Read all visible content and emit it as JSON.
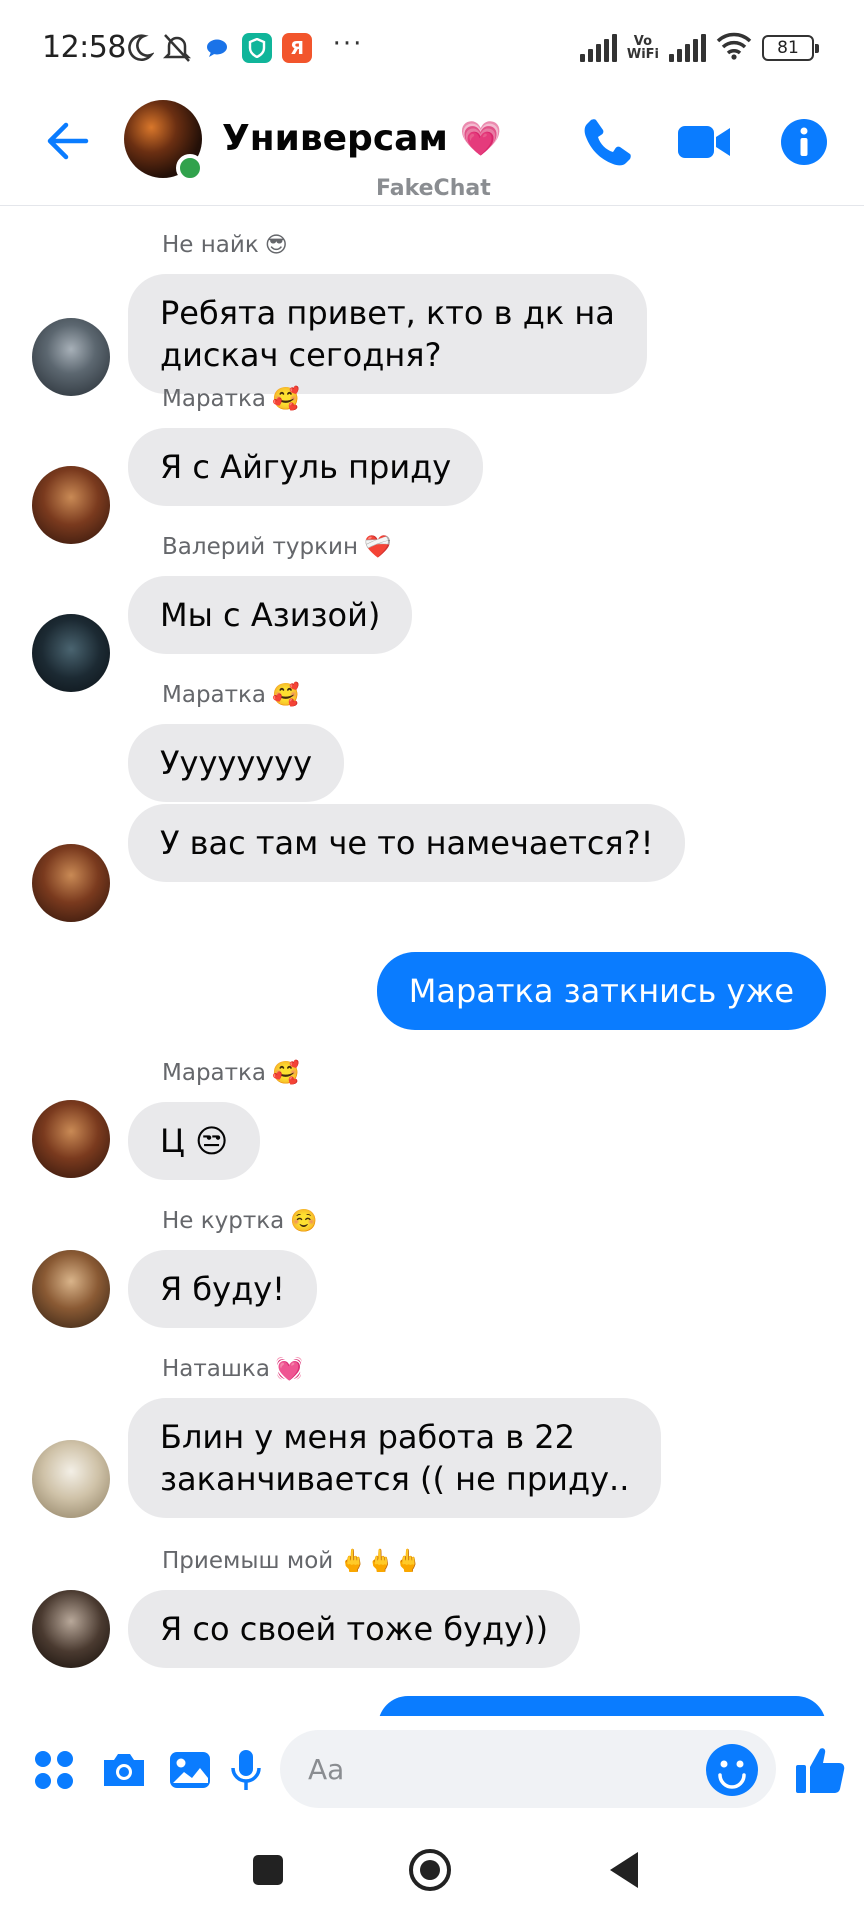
{
  "status_bar": {
    "time": "12:58",
    "network_label_top": "Vo",
    "network_label_bottom": "WiFi",
    "battery": "81",
    "more": "···",
    "ya_letter": "Я"
  },
  "header": {
    "title": "Универсам",
    "title_emoji": "💗",
    "watermark": "FakeChat"
  },
  "colors": {
    "accent": "#0a7cff",
    "incoming_bubble": "#e9e9eb",
    "online": "#31a24c",
    "sender_text": "#65676b"
  },
  "messages": [
    {
      "sender": "Не найк",
      "sender_emoji": "😎",
      "lines": [
        "Ребята привет, кто в дк на",
        "дискач сегодня?"
      ]
    },
    {
      "sender": "Маратка",
      "sender_emoji": "🥰",
      "lines": [
        "Я с Айгуль приду"
      ]
    },
    {
      "sender": "Валерий туркин",
      "sender_emoji": "❤️‍🩹",
      "lines": [
        "Мы с Азизой)"
      ]
    },
    {
      "sender": "Маратка",
      "sender_emoji": "🥰",
      "lines": [
        "Уууууууу"
      ]
    },
    {
      "lines": [
        "У вас там че то намечается?!"
      ]
    },
    {
      "lines": [
        "Маратка заткнись уже"
      ]
    },
    {
      "sender": "Маратка",
      "sender_emoji": "🥰",
      "lines": [
        "Ц 😒"
      ]
    },
    {
      "sender": "Не куртка",
      "sender_emoji": "☺️",
      "lines": [
        "Я буду!"
      ]
    },
    {
      "sender": "Наташка",
      "sender_emoji": "💓",
      "lines": [
        "Блин у меня работа в 22",
        "заканчивается (( не приду.."
      ]
    },
    {
      "sender": "Приемыш мой",
      "sender_emoji": "🖕🖕🖕",
      "lines": [
        "Я со своей тоже буду))"
      ]
    }
  ],
  "composer": {
    "placeholder": "Aa"
  },
  "icons": {
    "back": "arrow-left-icon",
    "call": "phone-icon",
    "video": "video-camera-icon",
    "info": "info-icon",
    "apps": "four-dots-icon",
    "camera": "camera-icon",
    "image": "image-icon",
    "mic": "microphone-icon",
    "emoji": "smiley-icon",
    "like": "thumbs-up-icon"
  }
}
